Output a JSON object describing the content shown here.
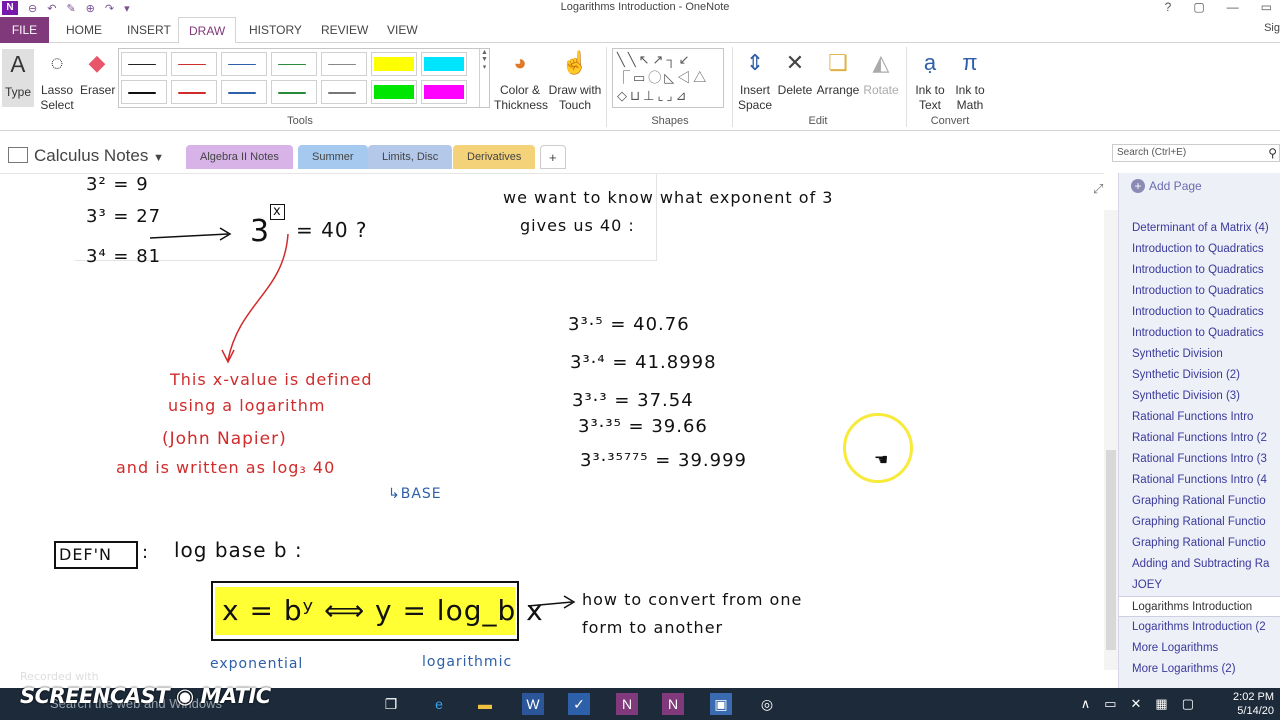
{
  "window": {
    "title": "Logarithms Introduction  -  OneNote",
    "controls": [
      "?",
      "▢",
      "—",
      "▭",
      "✕"
    ]
  },
  "ribbon_tabs": {
    "file": "FILE",
    "home": "HOME",
    "insert": "INSERT",
    "draw": "DRAW",
    "history": "HISTORY",
    "review": "REVIEW",
    "view": "VIEW",
    "signin": "Sig"
  },
  "ribbon": {
    "type": "Type",
    "lasso": "Lasso Select",
    "eraser": "Eraser",
    "color_thickness": "Color & Thickness",
    "draw_touch": "Draw with Touch",
    "insert_space": "Insert Space",
    "delete": "Delete",
    "arrange": "Arrange",
    "rotate": "Rotate",
    "ink_text": "Ink to Text",
    "ink_math": "Ink to Math",
    "group_tools": "Tools",
    "group_shapes": "Shapes",
    "group_edit": "Edit",
    "group_convert": "Convert"
  },
  "notebook": {
    "name": "Calculus Notes",
    "sections": [
      "Algebra II Notes",
      "Summer",
      "Limits, Disc",
      "Derivatives"
    ],
    "add_section": "+",
    "search_placeholder": "Search (Ctrl+E)"
  },
  "colors": {
    "onenote_purple": "#80397b",
    "ink_red": "#d12b2b",
    "ink_blue": "#2e5fa9",
    "highlight_yellow": "#ffff33",
    "section_algebra": "#d7b3e8",
    "section_summer": "#a6c9ef",
    "section_limits": "#b4c8ea",
    "section_derivatives": "#f4d27a"
  },
  "note": {
    "line1": "3² = 9",
    "line2": "3³ = 27",
    "line3": "3⁴ = 81",
    "question_base": "3",
    "question_exp": "x",
    "question_rest": "= 40 ?",
    "want1": "we  want   to  know   what exponent   of  3",
    "want2": "gives  us  40 :",
    "trial1": "3³·⁵ = 40.76",
    "trial2": "3³·⁴ = 41.8998",
    "trial3": "3³·³ = 37.54",
    "trial4": "3³·³⁵ = 39.66",
    "trial5": "3³·³⁵⁷⁷⁵ = 39.999",
    "red1": "This  x-value  is  defined",
    "red2": "using  a  logarithm",
    "red3": "(John  Napier)",
    "red4": "and  is  written  as  log₃ 40",
    "base_label": "↳BASE",
    "defn": "DEF'N",
    "defn_colon": ":",
    "log_base": "log  base  b :",
    "equation": "x = bʸ ⟺ y = log_b x",
    "convert1": "how  to  convert  from    one",
    "convert2": "form  to  another",
    "exponential": "exponential",
    "logarithmic": "logarithmic"
  },
  "pages": {
    "add_page": "Add Page",
    "items": [
      "Determinant of a Matrix (4)",
      "Introduction to Quadratics",
      "Introduction to Quadratics",
      "Introduction to Quadratics",
      "Introduction to Quadratics",
      "Introduction to Quadratics",
      "Synthetic Division",
      "Synthetic Division (2)",
      "Synthetic Division (3)",
      "Rational Functions Intro",
      "Rational Functions Intro (2",
      "Rational Functions Intro (3",
      "Rational Functions Intro (4",
      "Graphing Rational Functio",
      "Graphing Rational Functio",
      "Graphing Rational Functio",
      "Adding and Subtracting Ra",
      "JOEY",
      "Logarithms Introduction",
      "Logarithms Introduction (2",
      "More Logarithms",
      "More Logarithms (2)"
    ]
  },
  "taskbar": {
    "search": "Search the web and Windows",
    "time": "2:02 PM",
    "date": "5/14/20"
  },
  "watermark": {
    "recorded": "Recorded with",
    "brand": "SCREENCAST ◉ MATIC"
  }
}
